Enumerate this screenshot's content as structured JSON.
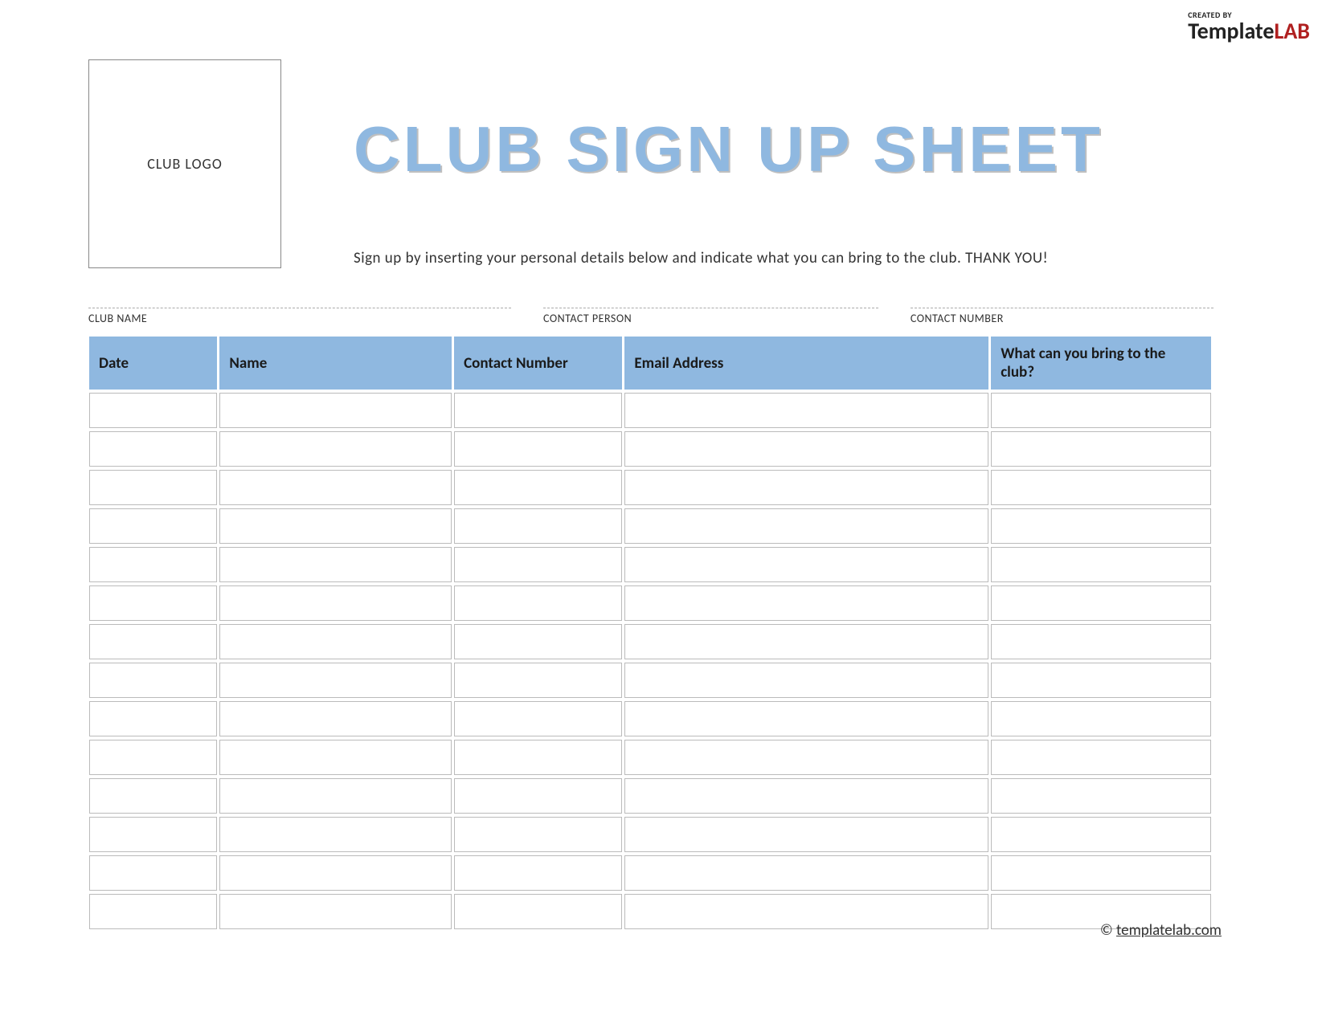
{
  "brand": {
    "created_by": "CREATED BY",
    "name_part1": "Template",
    "name_part2": "LAB"
  },
  "logo_placeholder": "CLUB LOGO",
  "main_title": "CLUB SIGN UP SHEET",
  "subtitle": "Sign up by inserting your personal details below and indicate what you can bring to the club. THANK YOU!",
  "info_fields": {
    "club_name_label": "CLUB NAME",
    "contact_person_label": "CONTACT PERSON",
    "contact_number_label": "CONTACT NUMBER"
  },
  "table": {
    "headers": {
      "date": "Date",
      "name": "Name",
      "contact_number": "Contact Number",
      "email": "Email Address",
      "bring": "What can you bring to the club?"
    },
    "row_count": 14
  },
  "footer": {
    "copyright": "©",
    "link_text": "templatelab.com"
  }
}
